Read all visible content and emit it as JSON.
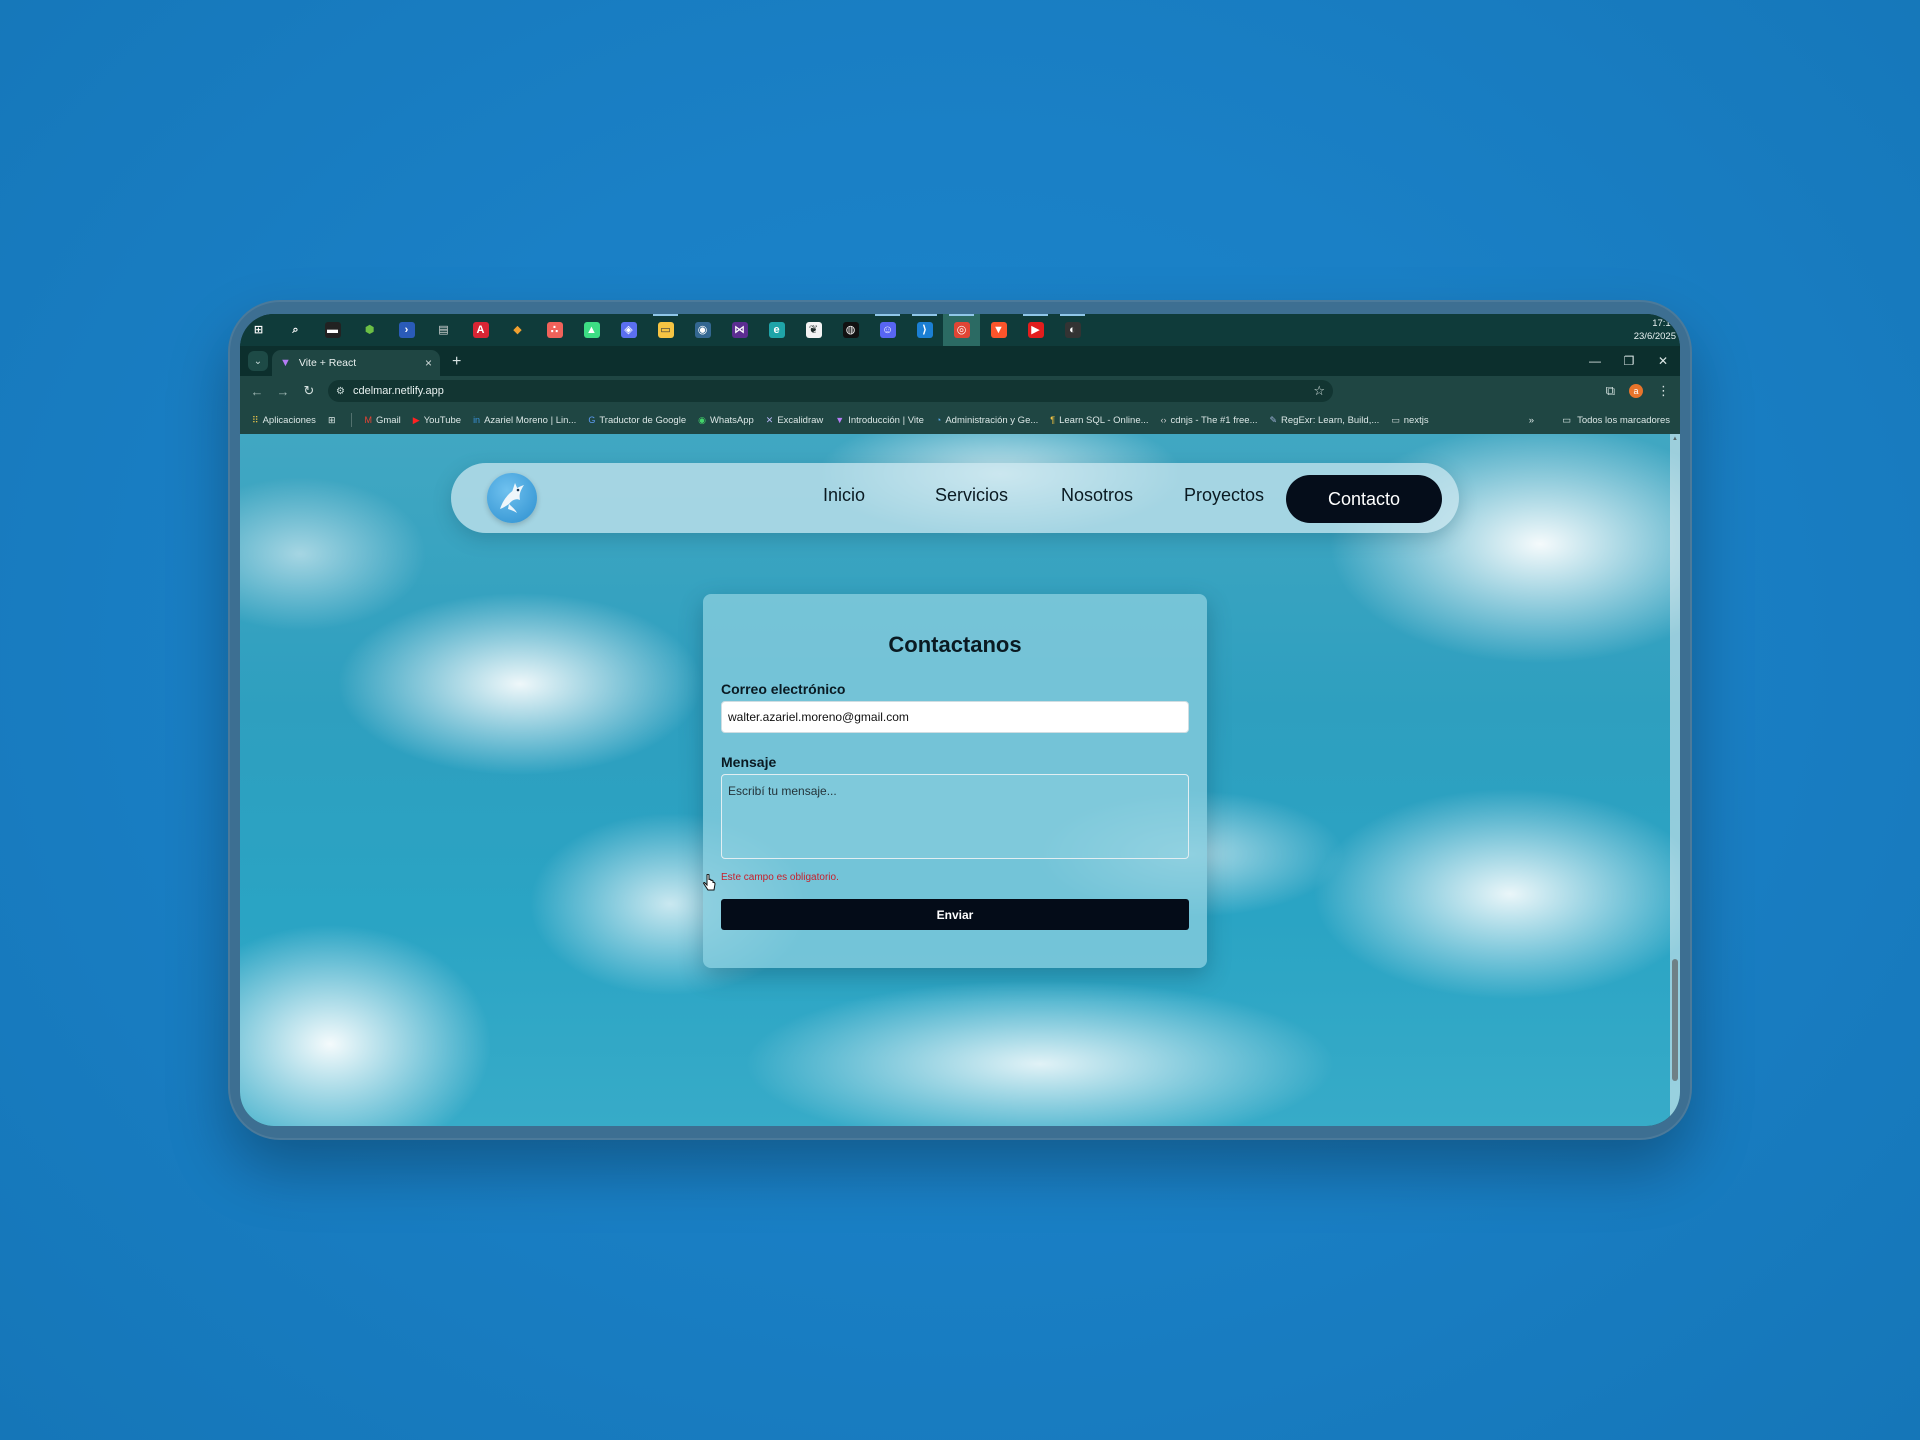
{
  "taskbar": {
    "icons": [
      {
        "name": "windows-start-icon",
        "glyph": "⊞",
        "color": "#ffffff",
        "bg": "transparent",
        "open": false,
        "active": false
      },
      {
        "name": "search-icon",
        "glyph": "⌕",
        "color": "#ffffff",
        "bg": "transparent",
        "open": false,
        "active": false
      },
      {
        "name": "terminal-icon",
        "glyph": "▬",
        "color": "#ffffff",
        "bg": "#222222",
        "open": false,
        "active": false
      },
      {
        "name": "node-icon",
        "glyph": "⬢",
        "color": "#6cbf45",
        "bg": "transparent",
        "open": false,
        "active": false
      },
      {
        "name": "powershell-icon",
        "glyph": "›",
        "color": "#ffffff",
        "bg": "#2a5bb8",
        "open": false,
        "active": false
      },
      {
        "name": "printer-icon",
        "glyph": "▤",
        "color": "#dddddd",
        "bg": "transparent",
        "open": false,
        "active": false
      },
      {
        "name": "pdf-reader-icon",
        "glyph": "A",
        "color": "#ffffff",
        "bg": "#d92534",
        "open": false,
        "active": false
      },
      {
        "name": "git-icon",
        "glyph": "◆",
        "color": "#f0a030",
        "bg": "transparent",
        "open": false,
        "active": false
      },
      {
        "name": "asana-icon",
        "glyph": "∴",
        "color": "#ffffff",
        "bg": "#f0625a",
        "open": false,
        "active": false
      },
      {
        "name": "android-studio-icon",
        "glyph": "▲",
        "color": "#ffffff",
        "bg": "#3ddc84",
        "open": false,
        "active": false
      },
      {
        "name": "copilot-icon",
        "glyph": "◈",
        "color": "#ffffff",
        "bg": "#5b6ff0",
        "open": false,
        "active": false
      },
      {
        "name": "file-explorer-icon",
        "glyph": "▭",
        "color": "#3b3b3b",
        "bg": "#f6c443",
        "open": true,
        "active": false
      },
      {
        "name": "postgresql-icon",
        "glyph": "◉",
        "color": "#ffffff",
        "bg": "#336791",
        "open": false,
        "active": false
      },
      {
        "name": "visual-studio-icon",
        "glyph": "⋈",
        "color": "#ffffff",
        "bg": "#5c2d91",
        "open": false,
        "active": false
      },
      {
        "name": "edge-icon",
        "glyph": "e",
        "color": "#ffffff",
        "bg": "#1fa4a8",
        "open": false,
        "active": false
      },
      {
        "name": "mongodb-compass-icon",
        "glyph": "❦",
        "color": "#1e2b2a",
        "bg": "#f3f3f3",
        "open": false,
        "active": false
      },
      {
        "name": "github-icon",
        "glyph": "◍",
        "color": "#ffffff",
        "bg": "#111111",
        "open": false,
        "active": false
      },
      {
        "name": "discord-icon",
        "glyph": "☺",
        "color": "#ffffff",
        "bg": "#5865f2",
        "open": true,
        "active": false
      },
      {
        "name": "vscode-icon",
        "glyph": "⟩",
        "color": "#ffffff",
        "bg": "#1b7fd4",
        "open": true,
        "active": false
      },
      {
        "name": "chrome-icon",
        "glyph": "◎",
        "color": "#ffffff",
        "bg": "#e04535",
        "open": true,
        "active": true
      },
      {
        "name": "brave-icon",
        "glyph": "▼",
        "color": "#ffffff",
        "bg": "#fb542b",
        "open": false,
        "active": false
      },
      {
        "name": "youtube-music-icon",
        "glyph": "▶",
        "color": "#ffffff",
        "bg": "#e21d1d",
        "open": true,
        "active": false
      },
      {
        "name": "obs-icon",
        "glyph": "◐",
        "color": "#ffffff",
        "bg": "#333333",
        "open": true,
        "active": false
      }
    ],
    "time": "17:15",
    "date": "23/6/2025"
  },
  "browser": {
    "tab_title": "Vite + React",
    "url": "cdelmar.netlify.app",
    "profile_initial": "a"
  },
  "bookmarks": {
    "apps_label": "Aplicaciones",
    "items": [
      {
        "label": "Gmail",
        "icon": "M",
        "color": "#ea4335"
      },
      {
        "label": "YouTube",
        "icon": "▶",
        "color": "#ff2222"
      },
      {
        "label": "Azariel Moreno | Lin...",
        "icon": "in",
        "color": "#3a8fd8"
      },
      {
        "label": "Traductor de Google",
        "icon": "G",
        "color": "#5e9bf2"
      },
      {
        "label": "WhatsApp",
        "icon": "◉",
        "color": "#43d46a"
      },
      {
        "label": "Excalidraw",
        "icon": "✕",
        "color": "#b7b6f5"
      },
      {
        "label": "Introducción | Vite",
        "icon": "▼",
        "color": "#b57cf5"
      },
      {
        "label": "Administración y Ge...",
        "icon": "◔",
        "color": "#5aa7e8"
      },
      {
        "label": "Learn SQL - Online...",
        "icon": "¶",
        "color": "#f5c542"
      },
      {
        "label": "cdnjs - The #1 free...",
        "icon": "‹›",
        "color": "#cfcfcf"
      },
      {
        "label": "RegExr: Learn, Build,...",
        "icon": "✎",
        "color": "#9fb2d8"
      },
      {
        "label": "nextjs",
        "icon": "▭",
        "color": "#cfd9d8"
      }
    ],
    "overflow": "»",
    "all_bookmarks": "Todos los marcadores"
  },
  "site": {
    "nav": [
      "Inicio",
      "Servicios",
      "Nosotros",
      "Proyectos"
    ],
    "cta": "Contacto",
    "form": {
      "title": "Contactanos",
      "email_label": "Correo electrónico",
      "email_value": "walter.azariel.moreno@gmail.com",
      "message_label": "Mensaje",
      "message_placeholder": "Escribí tu mensaje...",
      "error": "Este campo es obligatorio.",
      "submit": "Enviar"
    }
  }
}
